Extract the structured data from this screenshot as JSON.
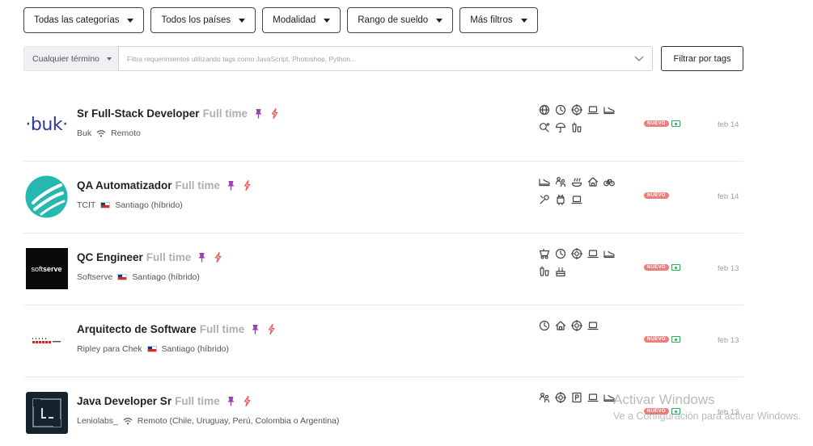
{
  "filters": [
    {
      "label": "Todas las categorías",
      "name": "filter-categories"
    },
    {
      "label": "Todos los países",
      "name": "filter-countries"
    },
    {
      "label": "Modalidad",
      "name": "filter-modality"
    },
    {
      "label": "Rango de sueldo",
      "name": "filter-salary"
    },
    {
      "label": "Más filtros",
      "name": "filter-more"
    }
  ],
  "search": {
    "term_label": "Cualquier término",
    "placeholder": "Filtra requerimientos utilizando tags como JavaScript, Photoshop, Python...",
    "filter_button": "Filtrar por tags"
  },
  "jobs": [
    {
      "title": "Sr Full-Stack Developer",
      "type": "Full time",
      "company": "Buk",
      "location": "Remoto",
      "loc_icon": "wifi-icon",
      "badge": "NUEVO",
      "date": "feb 14",
      "logo": "buk-logo",
      "logo_text": "·buk·",
      "has_money": true,
      "perks": [
        [
          "globe-icon",
          "clock-icon",
          "target-icon",
          "laptop-icon",
          "shoe-icon"
        ],
        [
          "ping-pong-icon",
          "umbrella-icon",
          "drinks-icon"
        ]
      ]
    },
    {
      "title": "QA Automatizador",
      "type": "Full time",
      "company": "TCIT",
      "location": "Santiago (híbrido)",
      "loc_icon": "chile-flag-icon",
      "badge": "NUEVO",
      "date": "feb 14",
      "logo": "tcit-logo",
      "has_money": false,
      "perks": [
        [
          "shoe-icon",
          "people-icon",
          "meal-icon",
          "home-icon",
          "bicycle-icon"
        ],
        [
          "tools-icon",
          "android-icon",
          "laptop-icon"
        ]
      ]
    },
    {
      "title": "QC Engineer",
      "type": "Full time",
      "company": "Softserve",
      "location": "Santiago (híbrido)",
      "loc_icon": "chile-flag-icon",
      "badge": "NUEVO",
      "date": "feb 13",
      "logo": "softserve-logo",
      "logo_text_a": "soft",
      "logo_text_b": "serve",
      "has_money": true,
      "perks": [
        [
          "baby-icon",
          "clock-icon",
          "target-icon",
          "laptop-icon",
          "shoe-icon"
        ],
        [
          "drinks-icon",
          "cake-icon"
        ]
      ]
    },
    {
      "title": "Arquitecto de Software",
      "type": "Full time",
      "company": "Ripley para Chek",
      "location": "Santiago (híbrido)",
      "loc_icon": "chile-flag-icon",
      "badge": "NUEVO",
      "date": "feb 13",
      "logo": "ripley-logo",
      "has_money": true,
      "perks": [
        [
          "clock-icon",
          "home-icon",
          "target-icon",
          "laptop-icon"
        ]
      ]
    },
    {
      "title": "Java Developer Sr",
      "type": "Full time",
      "company": "Leniolabs_",
      "location": "Remoto (Chile, Uruguay, Perú, Colombia o Argentina)",
      "loc_icon": "wifi-icon",
      "badge": "NUEVO",
      "date": "feb 13",
      "logo": "leniolabs-logo",
      "has_money": true,
      "perks": [
        [
          "people-icon",
          "target-icon",
          "parking-icon",
          "laptop-icon",
          "shoe-icon"
        ]
      ]
    }
  ],
  "watermark": {
    "line1": "Activar Windows",
    "line2": "Ve a Configuración para activar Windows."
  },
  "colors": {
    "accent_new": "#ef7d78",
    "pin": "#9b3fb5",
    "bolt": "#e85a5a",
    "money": "#2eae5a"
  }
}
